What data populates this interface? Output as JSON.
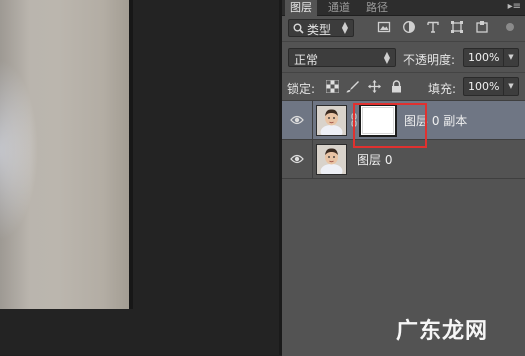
{
  "panel": {
    "tabs": [
      {
        "label": "图层",
        "active": true
      },
      {
        "label": "通道",
        "active": false
      },
      {
        "label": "路径",
        "active": false
      }
    ]
  },
  "filter": {
    "kind_label": "类型",
    "icons": [
      "image-filter-icon",
      "adjustment-filter-icon",
      "text-filter-icon",
      "shape-filter-icon",
      "smart-object-filter-icon"
    ]
  },
  "blend": {
    "mode": "正常",
    "opacity_label": "不透明度:",
    "opacity_value": "100%"
  },
  "lock": {
    "label": "锁定:",
    "icons": [
      "lock-transparent-icon",
      "lock-image-icon",
      "lock-position-icon",
      "lock-all-icon"
    ],
    "fill_label": "填充:",
    "fill_value": "100%"
  },
  "layers": [
    {
      "name": "图层 0 副本",
      "selected": true,
      "has_mask": true,
      "visible": true
    },
    {
      "name": "图层 0",
      "selected": false,
      "has_mask": false,
      "visible": true
    }
  ],
  "watermark": "广东龙网",
  "colors": {
    "selection": "#6f7684",
    "highlight": "#e0312f",
    "panel_bg": "#535353"
  }
}
